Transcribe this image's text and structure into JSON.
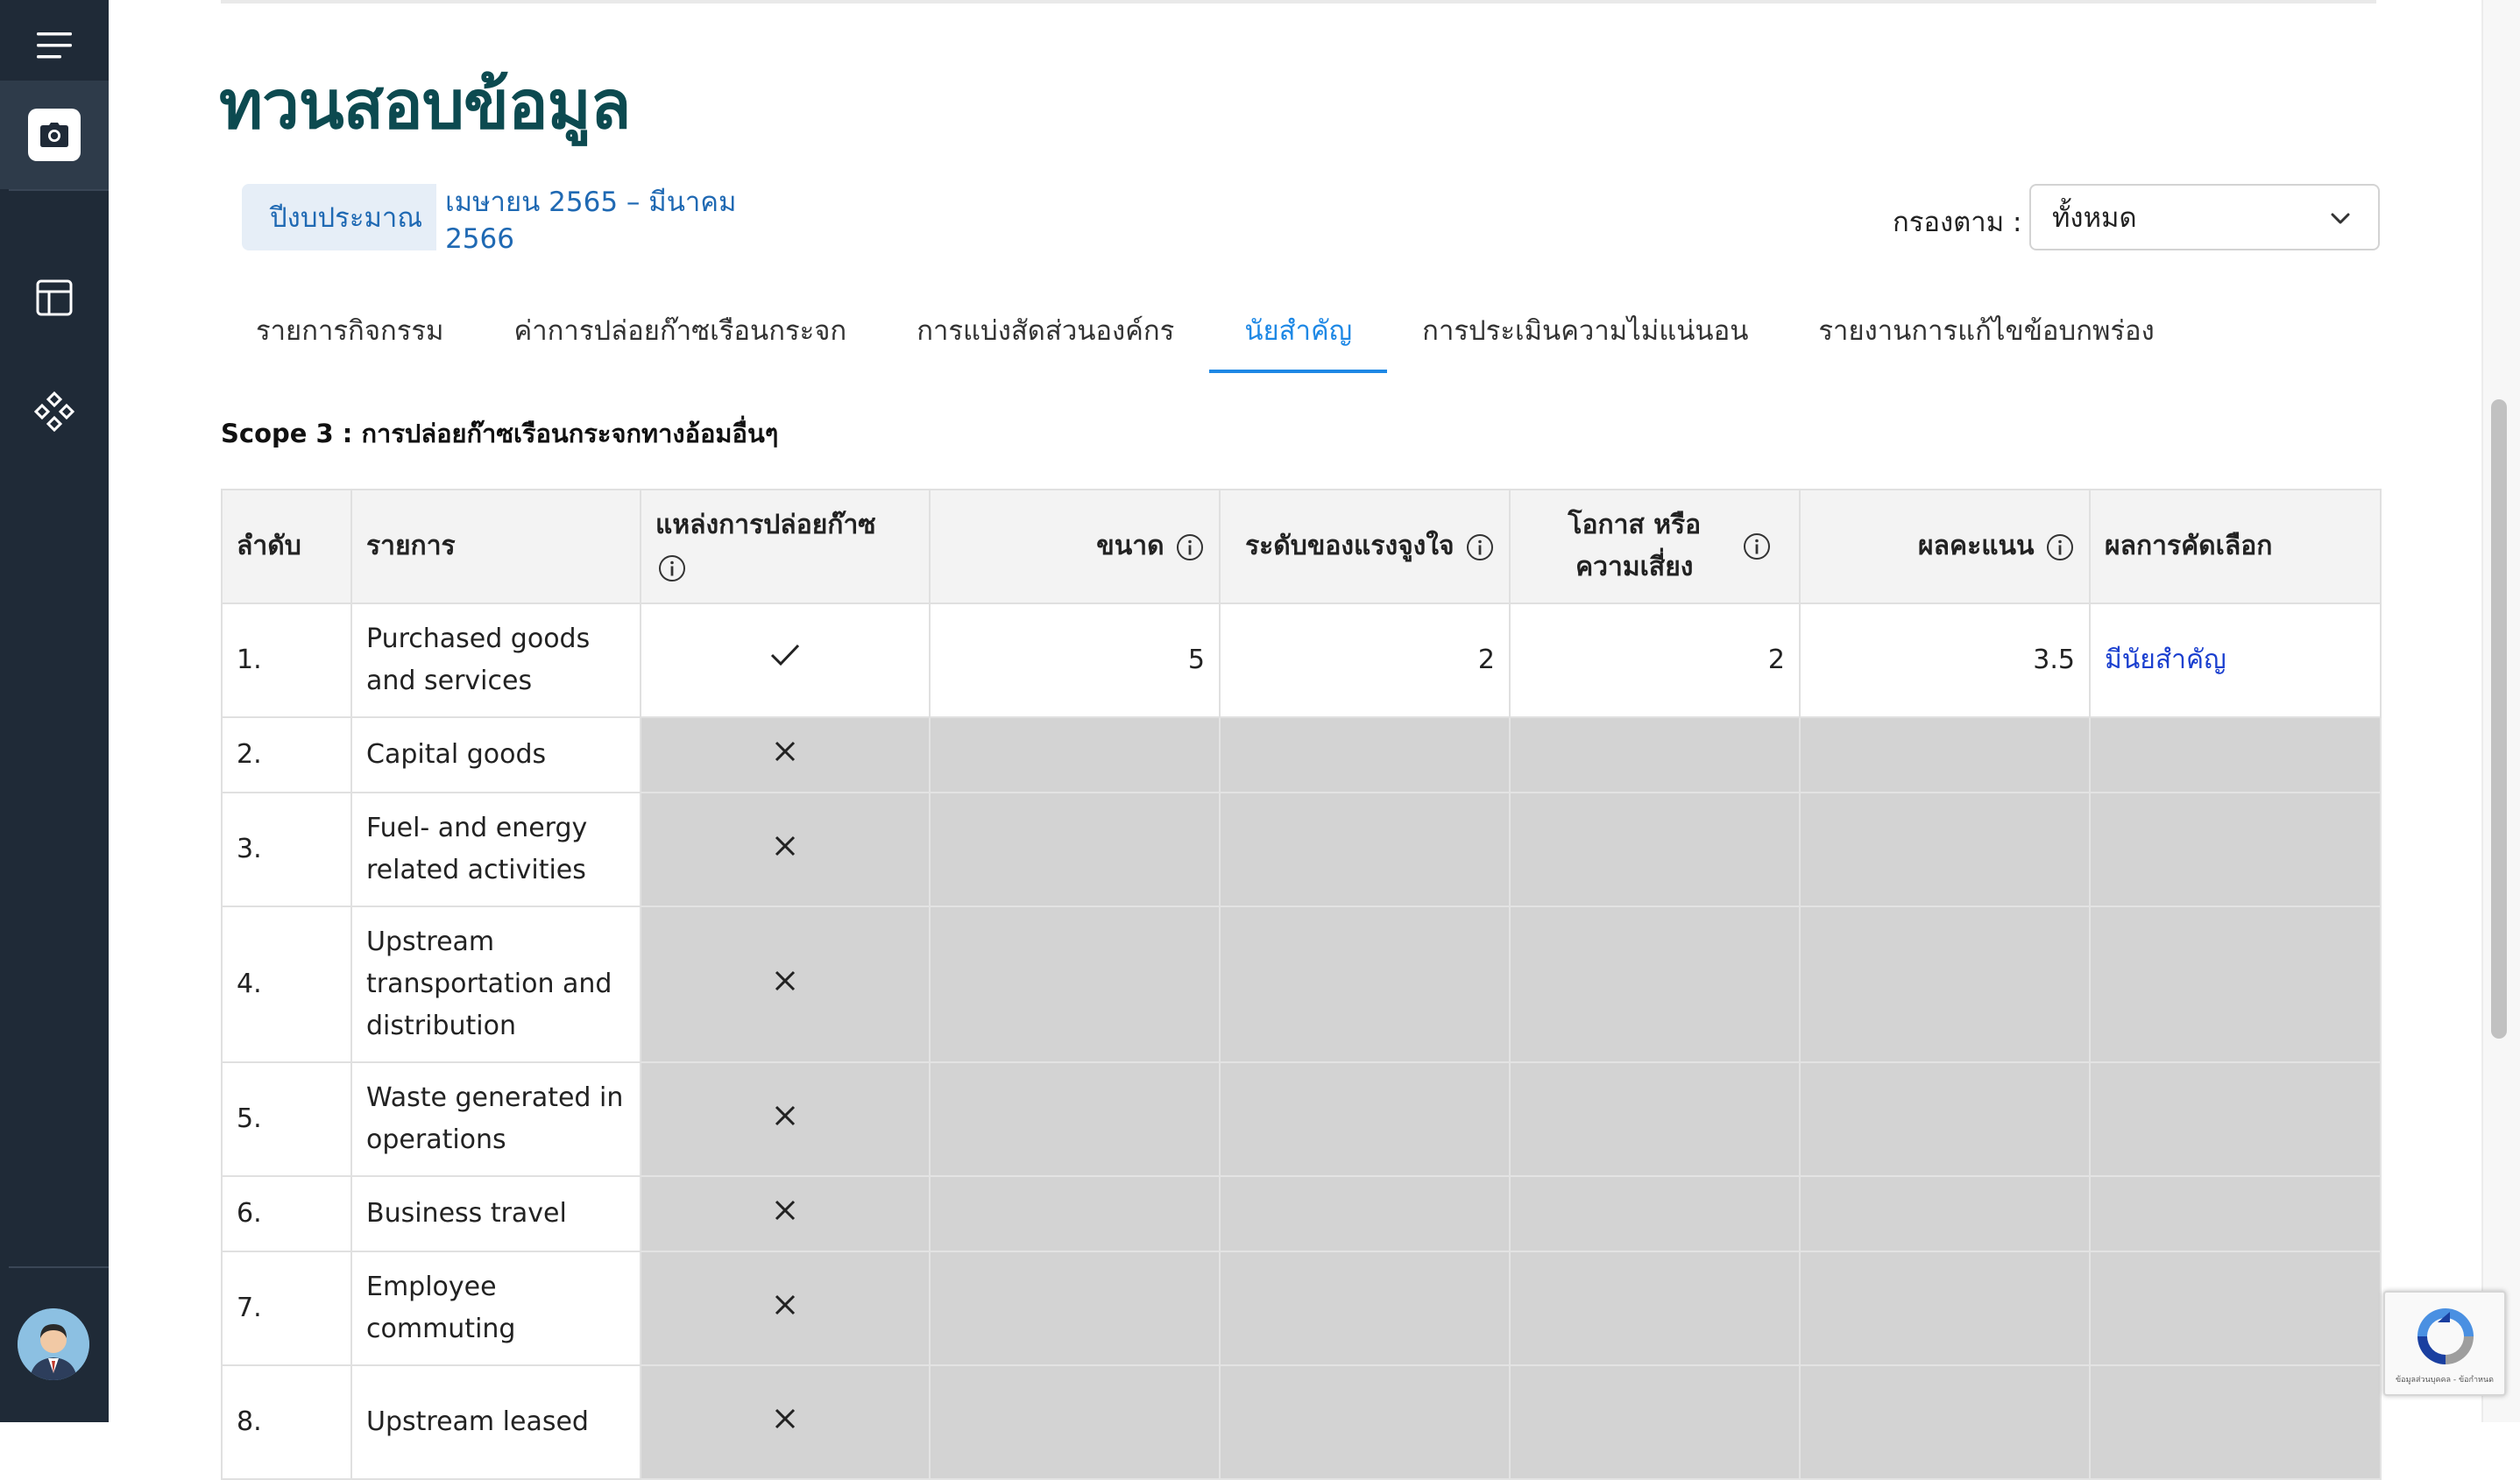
{
  "page": {
    "title": "ทวนสอบข้อมูล",
    "budget_label": "ปีงบประมาณ",
    "budget_value": "เมษายน 2565 – มีนาคม 2566",
    "filter_label": "กรองตาม :",
    "filter_value": "ทั้งหมด"
  },
  "tabs": [
    {
      "label": "รายการกิจกรรม",
      "active": false
    },
    {
      "label": "ค่าการปล่อยก๊าซเรือนกระจก",
      "active": false
    },
    {
      "label": "การแบ่งสัดส่วนองค์กร",
      "active": false
    },
    {
      "label": "นัยสำคัญ",
      "active": true
    },
    {
      "label": "การประเมินความไม่แน่นอน",
      "active": false
    },
    {
      "label": "รายงานการแก้ไขข้อบกพร่อง",
      "active": false
    }
  ],
  "section_title": "Scope 3 : การปล่อยก๊าซเรือนกระจกทางอ้อมอื่นๆ",
  "table": {
    "headers": {
      "no": "ลำดับ",
      "item": "รายการ",
      "source": "แหล่งการปล่อยก๊าซ",
      "size": "ขนาด",
      "motivation": "ระดับของแรงจูงใจ",
      "opportunity": "โอกาส หรือความเสี่ยง",
      "score": "ผลคะแนน",
      "result": "ผลการคัดเลือก"
    },
    "rows": [
      {
        "no": "1.",
        "item": "Purchased goods and services",
        "source": "check",
        "size": "5",
        "motivation": "2",
        "opportunity": "2",
        "score": "3.5",
        "result": "มีนัยสำคัญ"
      },
      {
        "no": "2.",
        "item": "Capital goods",
        "source": "cross"
      },
      {
        "no": "3.",
        "item": "Fuel- and energy related activities",
        "source": "cross"
      },
      {
        "no": "4.",
        "item": "Upstream transportation and distribution",
        "source": "cross"
      },
      {
        "no": "5.",
        "item": "Waste generated in operations",
        "source": "cross"
      },
      {
        "no": "6.",
        "item": "Business travel",
        "source": "cross"
      },
      {
        "no": "7.",
        "item": "Employee commuting",
        "source": "cross"
      },
      {
        "no": "8.",
        "item": "Upstream leased",
        "source": "cross"
      }
    ]
  },
  "recaptcha_text": "ข้อมูลส่วนบุคคล - ข้อกำหนด",
  "icons": {
    "menu": "hamburger-menu-icon",
    "camera": "camera-icon",
    "table": "layout-table-icon",
    "components": "components-icon",
    "avatar": "user-avatar",
    "info": "info-icon",
    "chevron": "chevron-down-icon",
    "check": "check-icon",
    "cross": "close-icon"
  },
  "colors": {
    "sidebar": "#1f2a37",
    "title": "#0c4a50",
    "accent": "#1e88e5",
    "link": "#1a3fcf",
    "disabled_cell": "#d3d3d3"
  }
}
